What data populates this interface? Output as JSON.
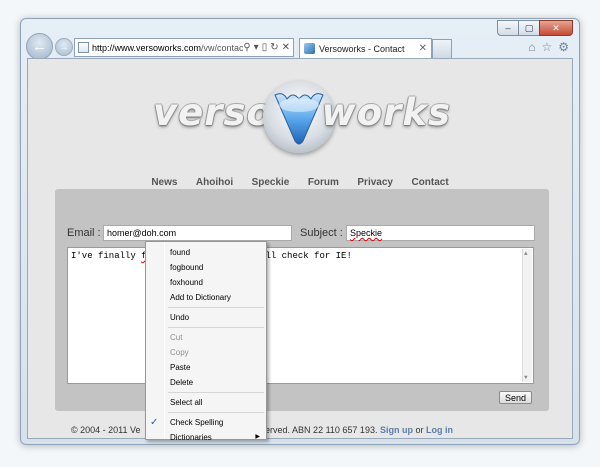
{
  "browser": {
    "window_controls": {
      "minimize": "–",
      "maximize": "▢",
      "close": "✕"
    },
    "address": {
      "url_domain": "http://www.versoworks.com",
      "url_path": "/vw/contact/"
    },
    "tab": {
      "title": "Versoworks - Contact",
      "close": "✕"
    }
  },
  "site": {
    "logo": {
      "left": "verso",
      "right": "works"
    },
    "menu": [
      "News",
      "Ahoihoi",
      "Speckie",
      "Forum",
      "Privacy",
      "Contact"
    ]
  },
  "form": {
    "email_label": "Email :",
    "email_value": "homer@doh.com",
    "subject_label": "Subject :",
    "subject_value": "Speckie",
    "message": {
      "before": "I've finally ",
      "misspelled": "fogunnd",
      "after": " a Real Time spell check for IE!"
    },
    "send_label": "Send"
  },
  "footer": {
    "text_start": "© 2004 - 2011 Ve",
    "text_end": "reserved. ABN 22 110 657 193.",
    "signup": "Sign up",
    "or": "or",
    "login": "Log in"
  },
  "context_menu": {
    "suggestions": [
      "found",
      "fogbound",
      "foxhound"
    ],
    "add_to_dictionary": "Add to Dictionary",
    "undo": "Undo",
    "cut": "Cut",
    "copy": "Copy",
    "paste": "Paste",
    "delete": "Delete",
    "select_all": "Select all",
    "check_spelling": "Check Spelling",
    "dictionaries": "Dictionaries"
  },
  "colors": {
    "accent_link": "#5b7da8",
    "spell_error": "#dd0000",
    "logo_blue": "#3a86d6"
  }
}
